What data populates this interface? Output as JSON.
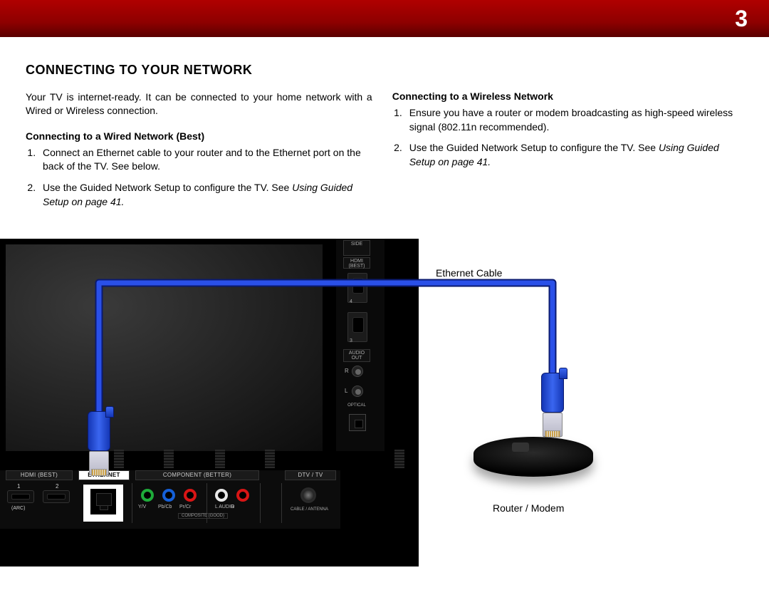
{
  "page_number": "3",
  "heading": "Connecting To Your Network",
  "intro": "Your TV is internet-ready. It can be connected to your home network with a Wired or Wireless connection.",
  "wired": {
    "title": "Connecting to a Wired Network (Best)",
    "step1": "Connect an Ethernet cable to your router and to the Ethernet port on the back of the TV. See below.",
    "step2a": "Use the Guided Network Setup to configure the TV. See ",
    "step2_ref": "Using Guided Setup on page 41.",
    "step2b": ""
  },
  "wireless": {
    "title": "Connecting to a Wireless Network",
    "step1": "Ensure you have a router or modem broadcasting as high-speed wireless signal (802.11n recommended).",
    "step2a": "Use the Guided Network Setup to configure the TV. See ",
    "step2_ref": "Using Guided Setup on page 41.",
    "step2b": ""
  },
  "diagram": {
    "ethernet_cable_label": "Ethernet Cable",
    "router_label": "Router / Modem"
  },
  "ports": {
    "side_section": "SIDE",
    "hdmi_best": "HDMI (BEST)",
    "hdmi_4": "4",
    "hdmi_3": "3",
    "audio_out": "AUDIO OUT",
    "r": "R",
    "l": "L",
    "optical": "OPTICAL",
    "bottom_hdmi_best": "HDMI (BEST)",
    "ethernet": "ETHERNET",
    "component_better": "COMPONENT (BETTER)",
    "dtv_tv": "DTV / TV",
    "num1": "1",
    "num2": "2",
    "arc": "(ARC)",
    "yv": "Y/V",
    "pbcb": "Pb/Cb",
    "prcr": "Pr/Cr",
    "l_audio": "L  AUDIO",
    "r_audio": "R",
    "composite_good": "COMPOSITE (GOOD)",
    "cable_antenna": "CABLE / ANTENNA"
  }
}
